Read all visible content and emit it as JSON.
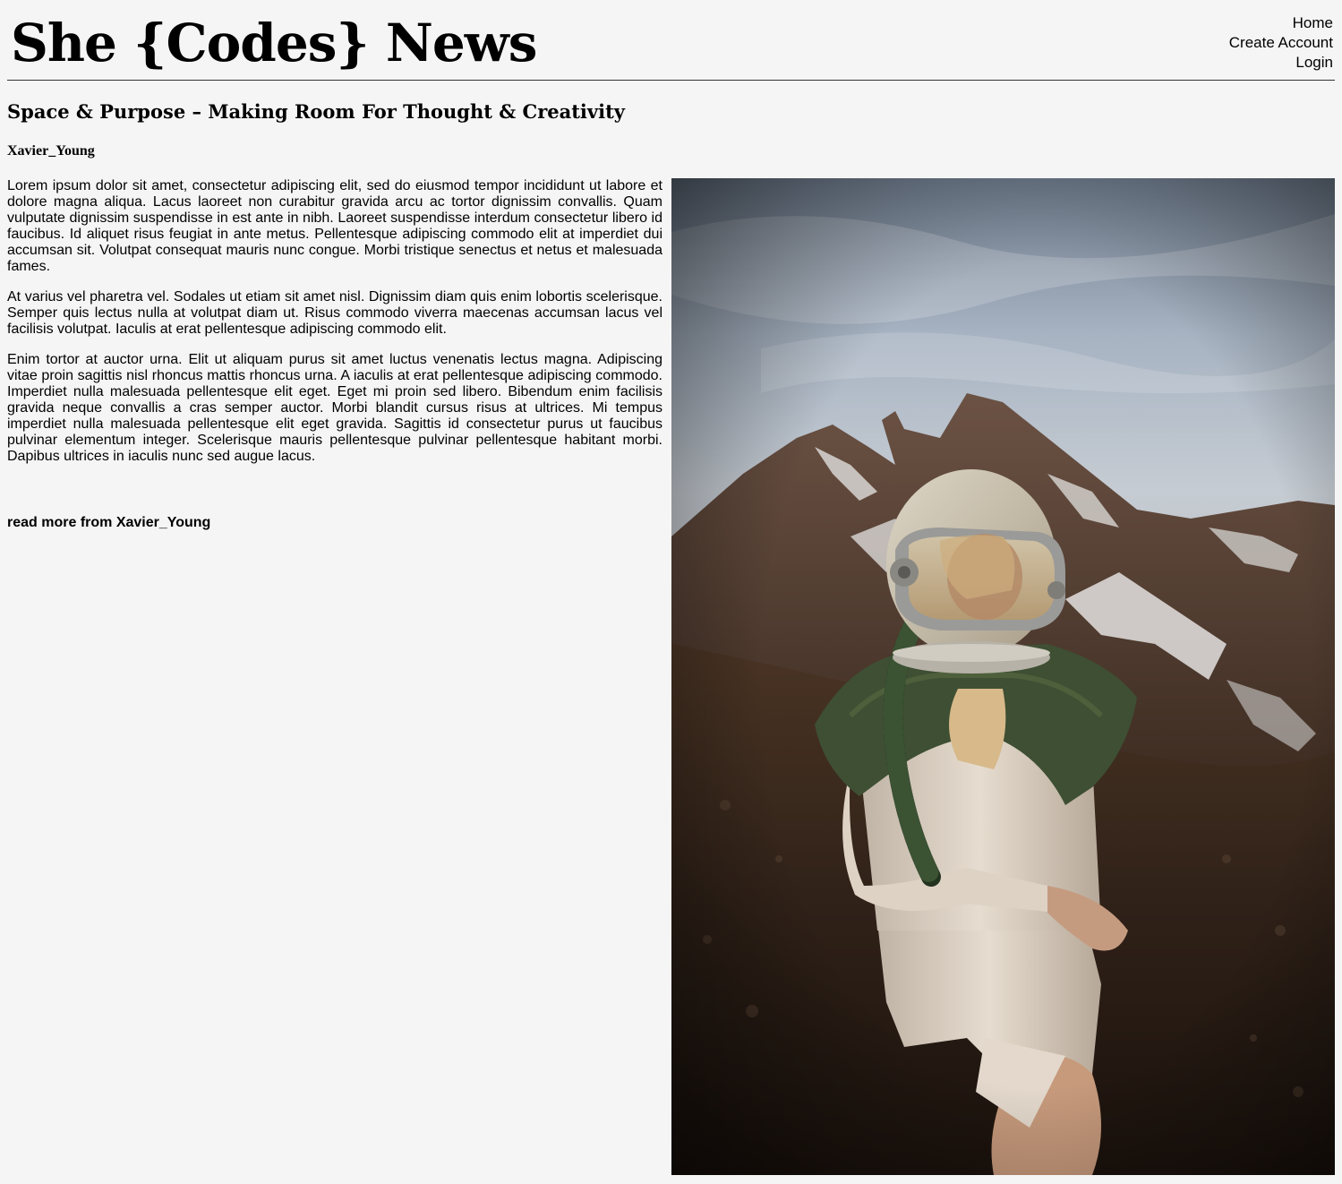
{
  "header": {
    "site_title": "She {Codes} News",
    "nav": {
      "home": "Home",
      "create_account": "Create Account",
      "login": "Login"
    }
  },
  "article": {
    "title": "Space & Purpose – Making Room For Thought & Creativity",
    "author": "Xavier_Young",
    "paragraphs": [
      "Lorem ipsum dolor sit amet, consectetur adipiscing elit, sed do eiusmod tempor incididunt ut labore et dolore magna aliqua. Lacus laoreet non curabitur gravida arcu ac tortor dignissim convallis. Quam vulputate dignissim suspendisse in est ante in nibh. Laoreet suspendisse interdum consectetur libero id faucibus. Id aliquet risus feugiat in ante metus. Pellentesque adipiscing commodo elit at imperdiet dui accumsan sit. Volutpat consequat mauris nunc congue. Morbi tristique senectus et netus et malesuada fames.",
      "At varius vel pharetra vel. Sodales ut etiam sit amet nisl. Dignissim diam quis enim lobortis scelerisque. Semper quis lectus nulla at volutpat diam ut. Risus commodo viverra maecenas accumsan lacus vel facilisis volutpat. Iaculis at erat pellentesque adipiscing commodo elit.",
      "Enim tortor at auctor urna. Elit ut aliquam purus sit amet luctus venenatis lectus magna. Adipiscing vitae proin sagittis nisl rhoncus mattis rhoncus urna. A iaculis at erat pellentesque adipiscing commodo. Imperdiet nulla malesuada pellentesque elit eget. Eget mi proin sed libero. Bibendum enim facilisis gravida neque convallis a cras semper auctor. Morbi blandit cursus risus at ultrices. Mi tempus imperdiet nulla malesuada pellentesque elit eget gravida. Sagittis id consectetur purus ut faucibus pulvinar elementum integer. Scelerisque mauris pellentesque pulvinar pellentesque habitant morbi. Dapibus ultrices in iaculis nunc sed augue lacus."
    ],
    "read_more": "read more from Xavier_Young"
  },
  "colors": {
    "page_background": "#f5f5f5",
    "text": "#000000"
  }
}
